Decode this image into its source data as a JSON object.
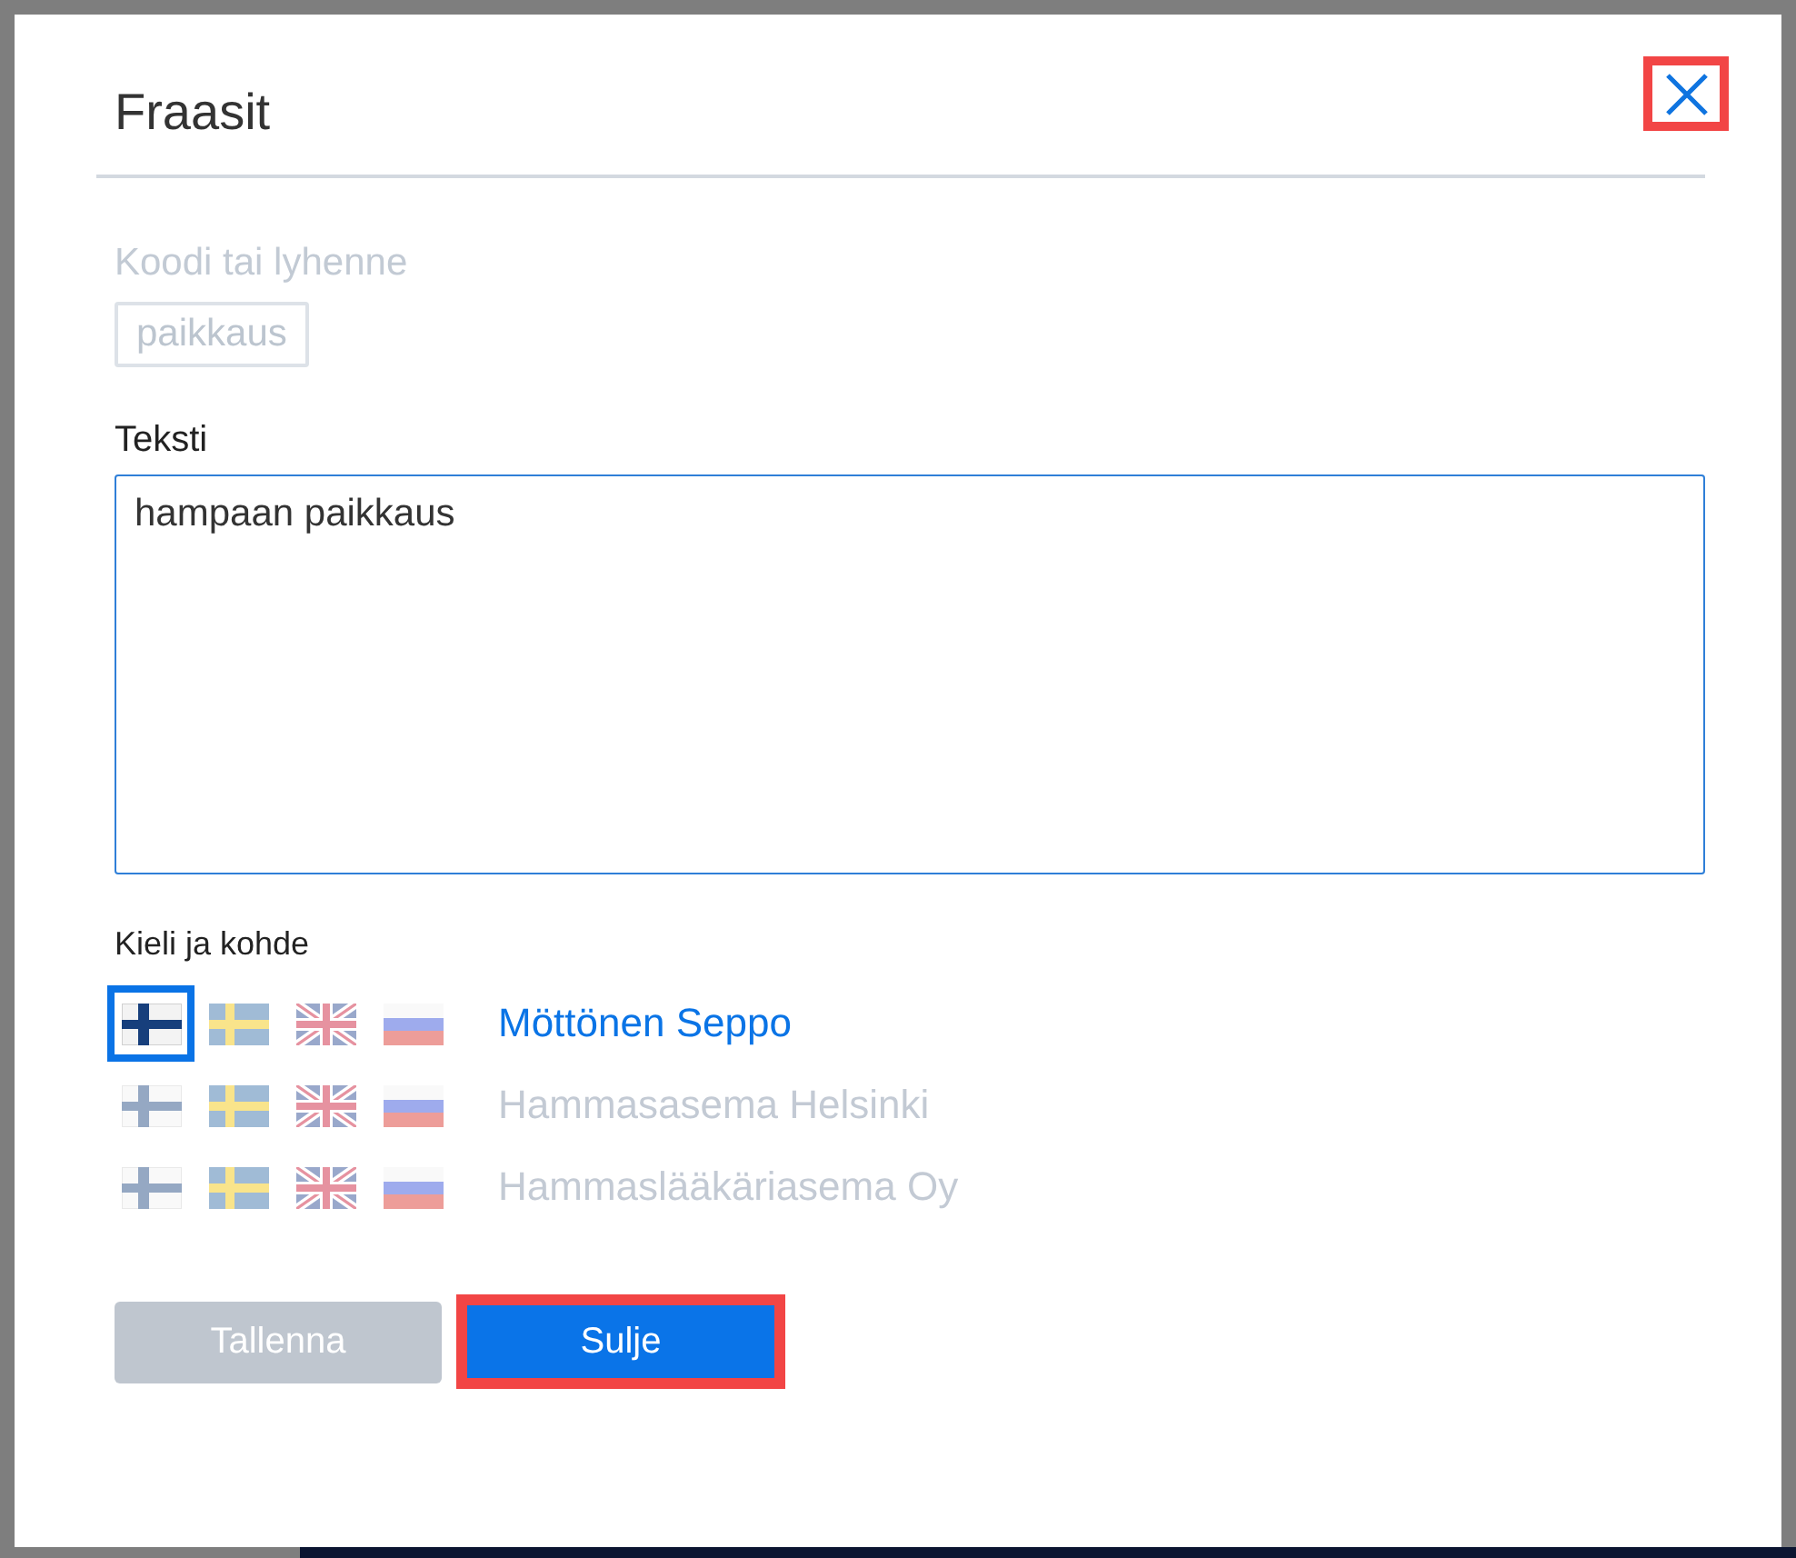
{
  "dialog": {
    "title": "Fraasit",
    "close_button": {
      "highlighted": true
    }
  },
  "code_field": {
    "label": "Koodi tai lyhenne",
    "value": "paikkaus",
    "disabled": true
  },
  "text_field": {
    "label": "Teksti",
    "value": "hampaan paikkaus"
  },
  "targets": {
    "label": "Kieli ja kohde",
    "rows": [
      {
        "name": "Möttönen Seppo",
        "active": true,
        "flags": [
          {
            "kind": "fi",
            "selected": true
          },
          {
            "kind": "se",
            "selected": false
          },
          {
            "kind": "gb",
            "selected": false
          },
          {
            "kind": "ru",
            "selected": false
          }
        ]
      },
      {
        "name": "Hammasasema Helsinki",
        "active": false,
        "flags": [
          {
            "kind": "fi",
            "selected": false
          },
          {
            "kind": "se",
            "selected": false
          },
          {
            "kind": "gb",
            "selected": false
          },
          {
            "kind": "ru",
            "selected": false
          }
        ]
      },
      {
        "name": "Hammaslääkäriasema Oy",
        "active": false,
        "flags": [
          {
            "kind": "fi",
            "selected": false
          },
          {
            "kind": "se",
            "selected": false
          },
          {
            "kind": "gb",
            "selected": false
          },
          {
            "kind": "ru",
            "selected": false
          }
        ]
      }
    ]
  },
  "buttons": [
    {
      "label": "Tallenna",
      "disabled": true,
      "highlighted": false
    },
    {
      "label": "Sulje",
      "disabled": false,
      "highlighted": true
    }
  ]
}
